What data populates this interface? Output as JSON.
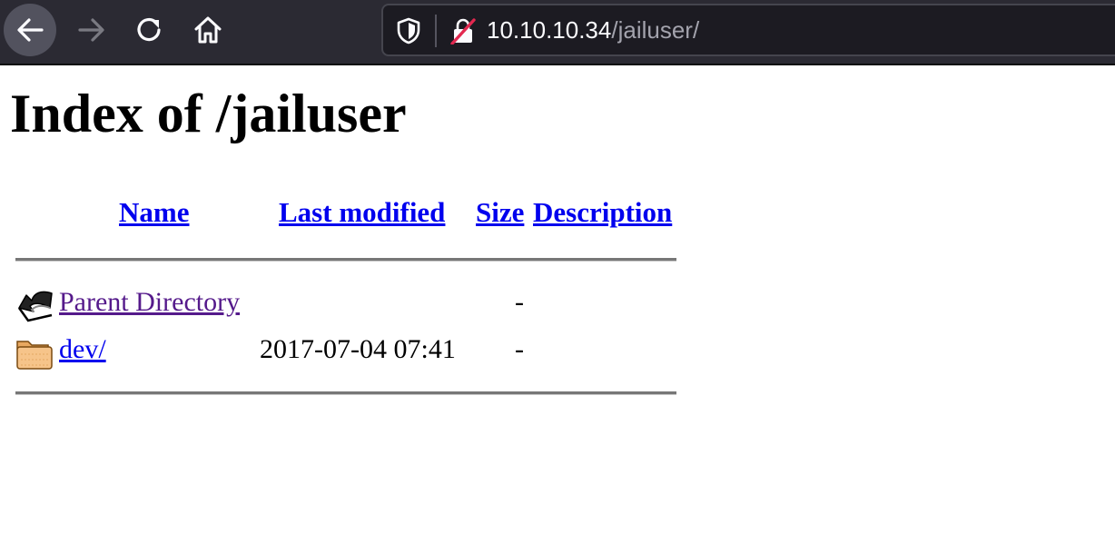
{
  "browser": {
    "url_host": "10.10.10.34",
    "url_path": "/jailuser/"
  },
  "page": {
    "title": "Index of /jailuser",
    "columns": {
      "name": "Name",
      "last_modified": "Last modified",
      "size": "Size",
      "description": "Description"
    },
    "rows": [
      {
        "icon": "back-icon",
        "name": "Parent Directory",
        "last_modified": "",
        "size": "-",
        "description": ""
      },
      {
        "icon": "folder-icon",
        "name": "dev/",
        "last_modified": "2017-07-04 07:41",
        "size": "-",
        "description": ""
      }
    ]
  },
  "colors": {
    "link": "#0000ee",
    "visited_link": "#551a8b",
    "toolbar_bg": "#2b2a33"
  }
}
